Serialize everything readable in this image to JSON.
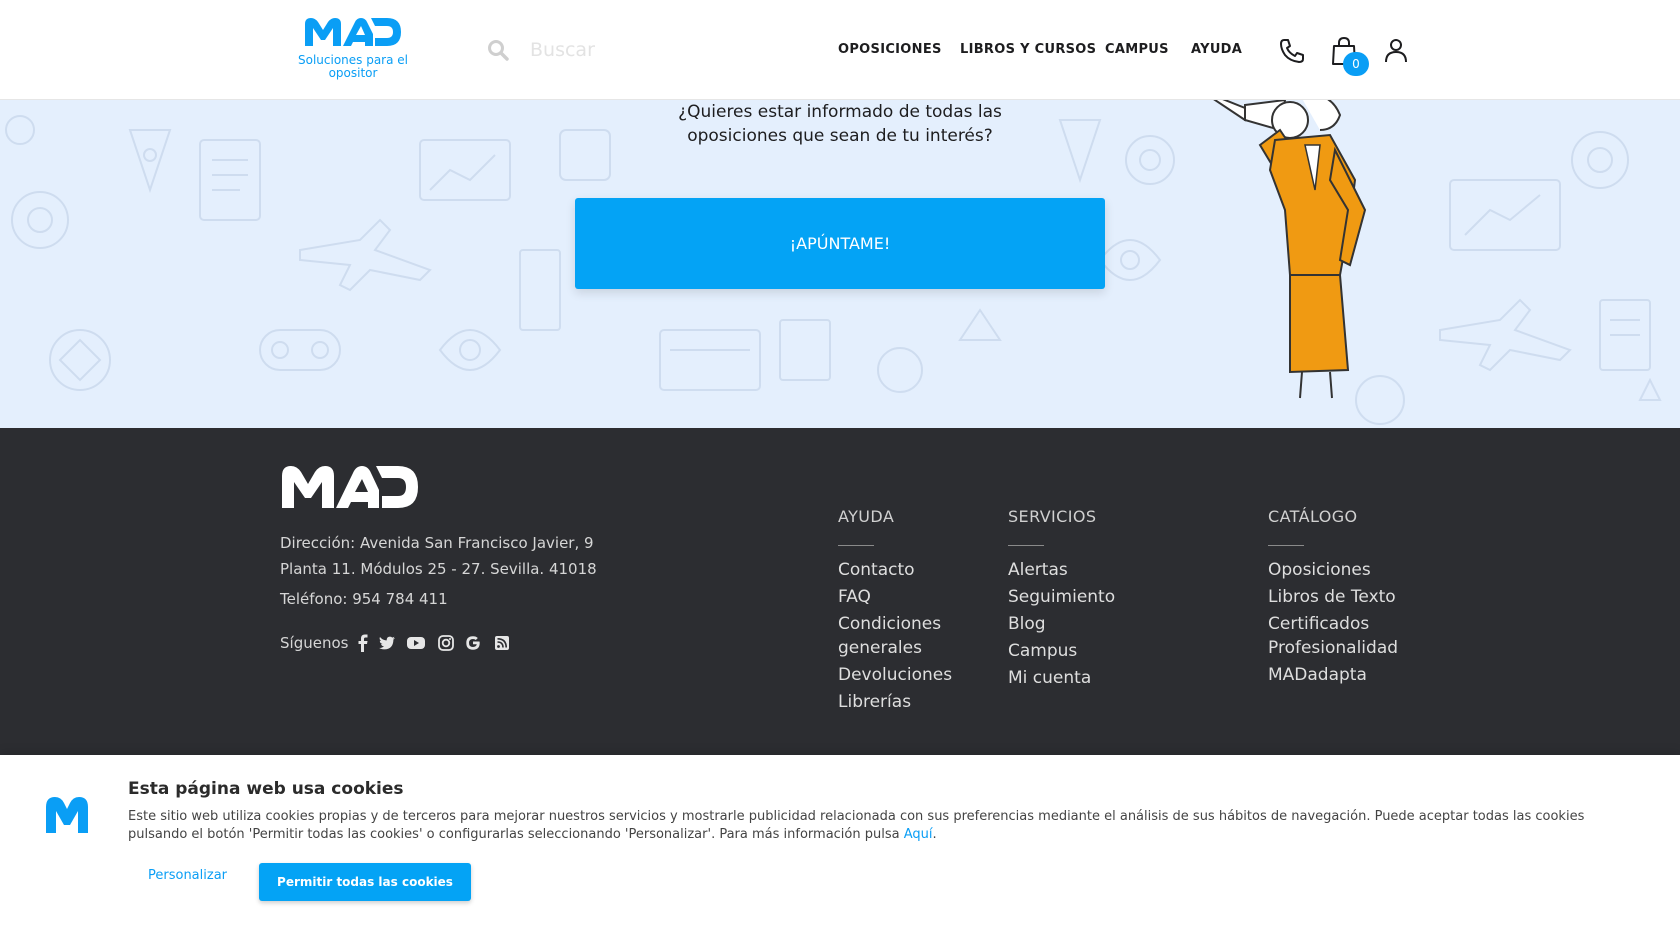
{
  "header": {
    "logo_text": "MAD",
    "tagline": "Soluciones para el opositor",
    "search_placeholder": "Buscar",
    "nav": [
      "OPOSICIONES",
      "LIBROS Y CURSOS",
      "CAMPUS",
      "AYUDA"
    ],
    "cart_count": "0",
    "icons": [
      "phone-icon",
      "shopping-bag-icon",
      "user-icon",
      "search-icon"
    ]
  },
  "hero": {
    "line1": "¿Quieres estar informado de todas las",
    "line2": "oposiciones que sean de tu interés?",
    "button": "¡APÚNTAME!"
  },
  "footer": {
    "logo_text": "MAD",
    "address_line1": "Dirección: Avenida San Francisco Javier, 9",
    "address_line2": "Planta 11. Módulos 25 - 27. Sevilla. 41018",
    "phone": "Teléfono: 954 784 411",
    "follow": "Síguenos",
    "social_icons": [
      "facebook-icon",
      "twitter-icon",
      "youtube-icon",
      "instagram-icon",
      "google-icon",
      "rss-icon"
    ],
    "columns": [
      {
        "title": "AYUDA",
        "links": [
          "Contacto",
          "FAQ",
          "Condiciones generales",
          "Devoluciones",
          "Librerías"
        ]
      },
      {
        "title": "SERVICIOS",
        "links": [
          "Alertas",
          "Seguimiento",
          "Blog",
          "Campus",
          "Mi cuenta"
        ]
      },
      {
        "title": "CATÁLOGO",
        "links": [
          "Oposiciones",
          "Libros de Texto",
          "Certificados Profesionalidad",
          "MADadapta"
        ]
      }
    ]
  },
  "cookies": {
    "title": "Esta página web usa cookies",
    "body": "Este sitio web utiliza cookies propias y de terceros para mejorar nuestros servicios y mostrarle publicidad relacionada con sus preferencias mediante el análisis de sus hábitos de navegación. Puede aceptar todas las cookies pulsando el botón 'Permitir todas las cookies' o configurarlas seleccionando 'Personalizar'. Para más información pulsa",
    "link": "Aquí",
    "after_link": ".",
    "personalize": "Personalizar",
    "accept": "Permitir todas las cookies"
  },
  "colors": {
    "brand_blue": "#04a3f5",
    "footer_bg": "#2c2d31",
    "hero_bg": "#e4effd",
    "accent_orange": "#f09a12"
  }
}
